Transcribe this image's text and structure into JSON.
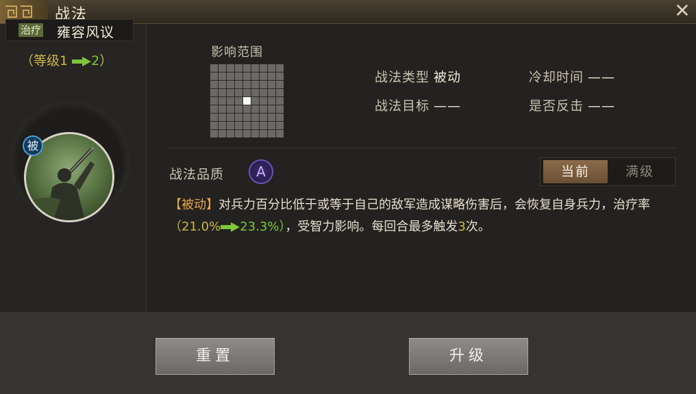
{
  "window": {
    "title": "战法",
    "close_icon": "close-icon"
  },
  "skill": {
    "category_tag": "治疗",
    "name": "雍容风议",
    "level": {
      "prefix": "（等级",
      "from": "1",
      "to": "2",
      "suffix": "）"
    },
    "passive_badge": "被"
  },
  "range": {
    "label": "影响范围",
    "grid_size": 9,
    "center_highlight": true
  },
  "info": {
    "type_label": "战法类型",
    "type_value": "被动",
    "cooldown_label": "冷却时间",
    "cooldown_value": "——",
    "target_label": "战法目标",
    "target_value": "——",
    "counter_label": "是否反击",
    "counter_value": "——"
  },
  "quality": {
    "label": "战法品质",
    "grade": "A"
  },
  "toggle": {
    "current": "当前",
    "max": "满级"
  },
  "description": {
    "tag": "【被动】",
    "text1": "对兵力百分比低于或等于自己的敌军造成谋略伤害后，会恢复自身兵力，治疗率",
    "open": "（",
    "old_value": "21.0%",
    "new_value": "23.3%",
    "close": "）",
    "text2": "，受智力影响。每回合最多触发",
    "count": "3",
    "text3": "次。"
  },
  "buttons": {
    "reset": "重置",
    "upgrade": "升级"
  },
  "colors": {
    "accent_gold": "#cdb845",
    "accent_green": "#7fc63a",
    "tag_orange": "#e7a64a",
    "quality_purple": "#6a55b8"
  }
}
